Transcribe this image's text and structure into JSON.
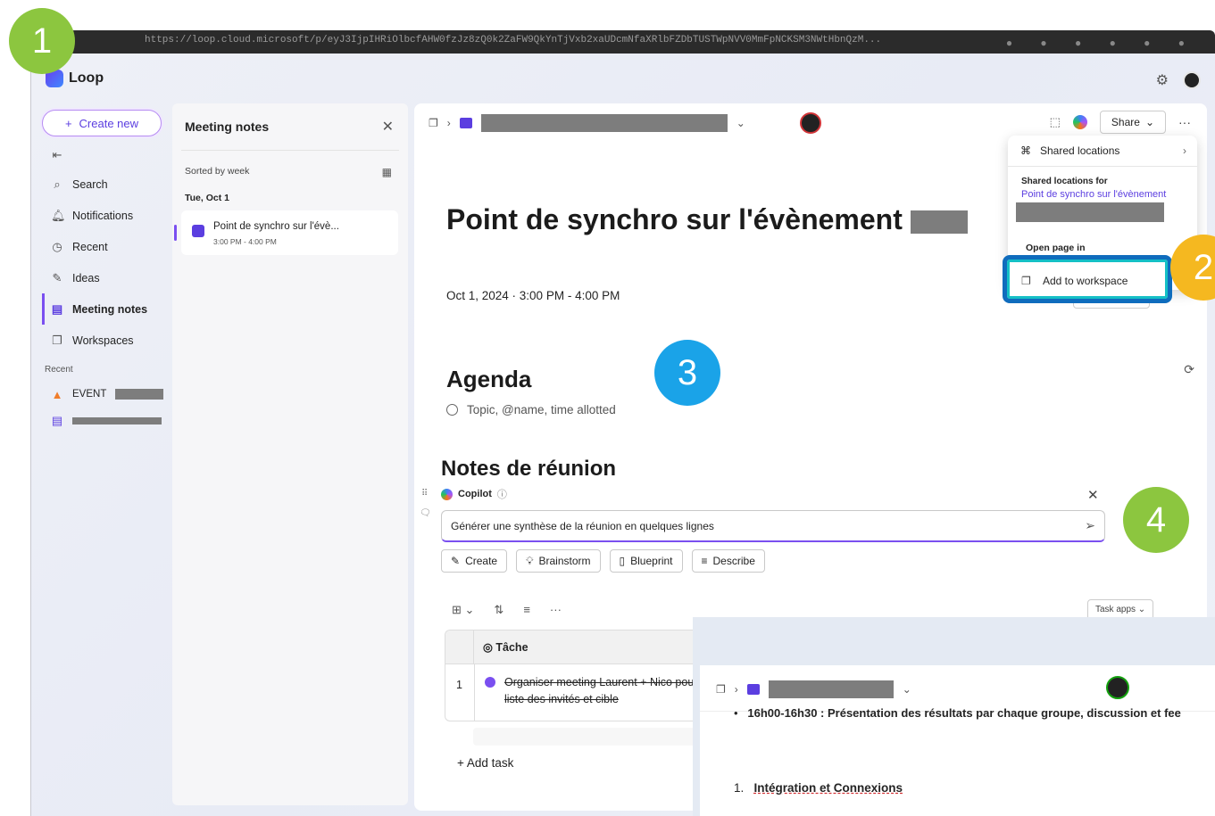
{
  "browser": {
    "url": "https://loop.cloud.microsoft/p/eyJ3IjpIHRiOlbcfAHW0fzJz8zQ0k2ZaFW9QkYnTjVxb2xaUDcmNfaXRlbFZDbTUSTWpNVV0MmFpNCKSM3NWtHbnQzM..."
  },
  "app": {
    "name": "Loop",
    "brand_color": "#6a3cf0"
  },
  "nav": {
    "create_label": "Create new",
    "items": [
      {
        "label": "Search",
        "icon": "search-icon"
      },
      {
        "label": "Notifications",
        "icon": "bell-icon"
      },
      {
        "label": "Recent",
        "icon": "clock-icon"
      },
      {
        "label": "Ideas",
        "icon": "pen-icon"
      },
      {
        "label": "Meeting notes",
        "icon": "notes-icon"
      },
      {
        "label": "Workspaces",
        "icon": "workspace-icon"
      }
    ],
    "recent_header": "Recent",
    "recent_items": [
      "EVENT"
    ]
  },
  "notes_panel": {
    "title": "Meeting notes",
    "sorted_label": "Sorted by week",
    "date_label": "Tue, Oct 1",
    "card_title": "Point de synchro sur l'évè...",
    "card_time": "3:00 PM - 4:00 PM"
  },
  "page": {
    "title": "Point de synchro sur l'évènement",
    "meta": "Oct 1, 2024 · 3:00 PM - 4:00 PM",
    "agenda_heading": "Agenda",
    "agenda_placeholder": "Topic, @name, time allotted",
    "notes_heading": "Notes de réunion",
    "share_label": "Share"
  },
  "copilot": {
    "label": "Copilot",
    "input_value": "Générer une synthèse de la réunion en quelques lignes",
    "chips": [
      "Create",
      "Brainstorm",
      "Blueprint",
      "Describe"
    ]
  },
  "task_table": {
    "tools_label": "Task apps",
    "column": "Tâche",
    "rows": [
      {
        "num": "1",
        "text": "Organiser meeting Laurent + Nico pour la liste des invités et cible"
      }
    ],
    "add_task": "Add task"
  },
  "share_menu": {
    "shared_locations": "Shared locations",
    "shared_for": "Shared locations for",
    "shared_link": "Point de synchro sur l'évènement",
    "open_page_in": "Open page in",
    "add_to_workspace": "Add to workspace"
  },
  "overlay": {
    "bullet": "16h00-16h30 : Présentation des résultats par chaque groupe, discussion et fee",
    "numbered_num": "1.",
    "numbered": "Intégration et Connexions"
  },
  "badges": [
    {
      "label": "1",
      "color": "#8cc63f"
    },
    {
      "label": "2",
      "color": "#f5b820"
    },
    {
      "label": "3",
      "color": "#1aa3e8"
    },
    {
      "label": "4",
      "color": "#8cc63f"
    }
  ]
}
